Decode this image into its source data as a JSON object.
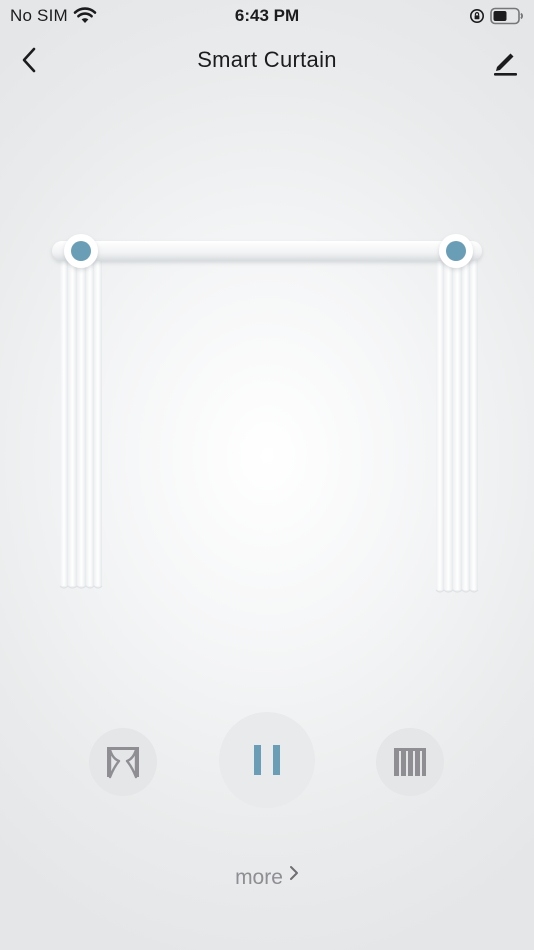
{
  "status_bar": {
    "carrier": "No SIM",
    "time": "6:43 PM"
  },
  "header": {
    "title": "Smart Curtain"
  },
  "curtain": {
    "open_fraction": 1.0
  },
  "controls": {
    "open_icon": "curtain-open-icon",
    "pause_icon": "pause-icon",
    "close_icon": "curtain-close-icon"
  },
  "footer": {
    "more_label": "more"
  },
  "colors": {
    "accent": "#6a9eb6",
    "control_bg": "#e4e6e8",
    "control_icon": "#8e8e93"
  }
}
